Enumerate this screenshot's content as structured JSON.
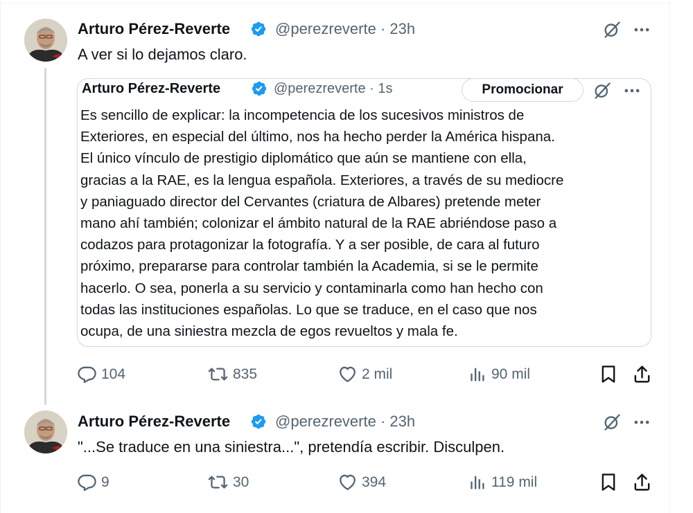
{
  "tweets": [
    {
      "author_name": "Arturo Pérez-Reverte",
      "handle": "@perezreverte",
      "separator": "·",
      "time": "23h",
      "text": "A ver si lo dejamos claro.",
      "quote": {
        "author_name": "Arturo Pérez-Reverte",
        "handle": "@perezreverte",
        "separator": "·",
        "time": "1s",
        "promote_label": "Promocionar",
        "lines": [
          "Es sencillo de explicar: la incompetencia de los sucesivos ministros de",
          "Exteriores, en especial del último, nos ha hecho perder la América hispana.",
          "El único vínculo de prestigio diplomático que aún se mantiene con ella,",
          "gracias a la RAE, es la lengua española. Exteriores, a través de su mediocre",
          "y paniaguado director del Cervantes (criatura de Albares) pretende meter",
          "mano ahí también; colonizar el ámbito natural de la RAE abriéndose paso a",
          "codazos para protagonizar la fotografía. Y a ser posible, de cara al futuro",
          "próximo, prepararse para controlar también la Academia, si se le permite",
          "hacerlo. O sea, ponerla a su servicio y contaminarla como han hecho con",
          "todas las instituciones españolas. Lo que se traduce, en el caso que nos",
          "ocupa, de una siniestra mezcla de egos revueltos y mala fe."
        ]
      },
      "metrics": {
        "replies": "104",
        "reposts": "835",
        "likes": "2 mil",
        "views": "90 mil"
      }
    },
    {
      "author_name": "Arturo Pérez-Reverte",
      "handle": "@perezreverte",
      "separator": "·",
      "time": "23h",
      "text": "\"...Se traduce en una siniestra...\", pretendía escribir. Disculpen.",
      "metrics": {
        "replies": "9",
        "reposts": "30",
        "likes": "394",
        "views": "119 mil"
      }
    }
  ],
  "colors": {
    "text": "#0f1419",
    "secondary": "#536471",
    "verified": "#1d9bf0",
    "border": "#cfd9de"
  },
  "icons": [
    "verified-badge-icon",
    "grok-icon",
    "more-icon",
    "reply-icon",
    "repost-icon",
    "like-icon",
    "views-icon",
    "bookmark-icon",
    "share-icon"
  ]
}
